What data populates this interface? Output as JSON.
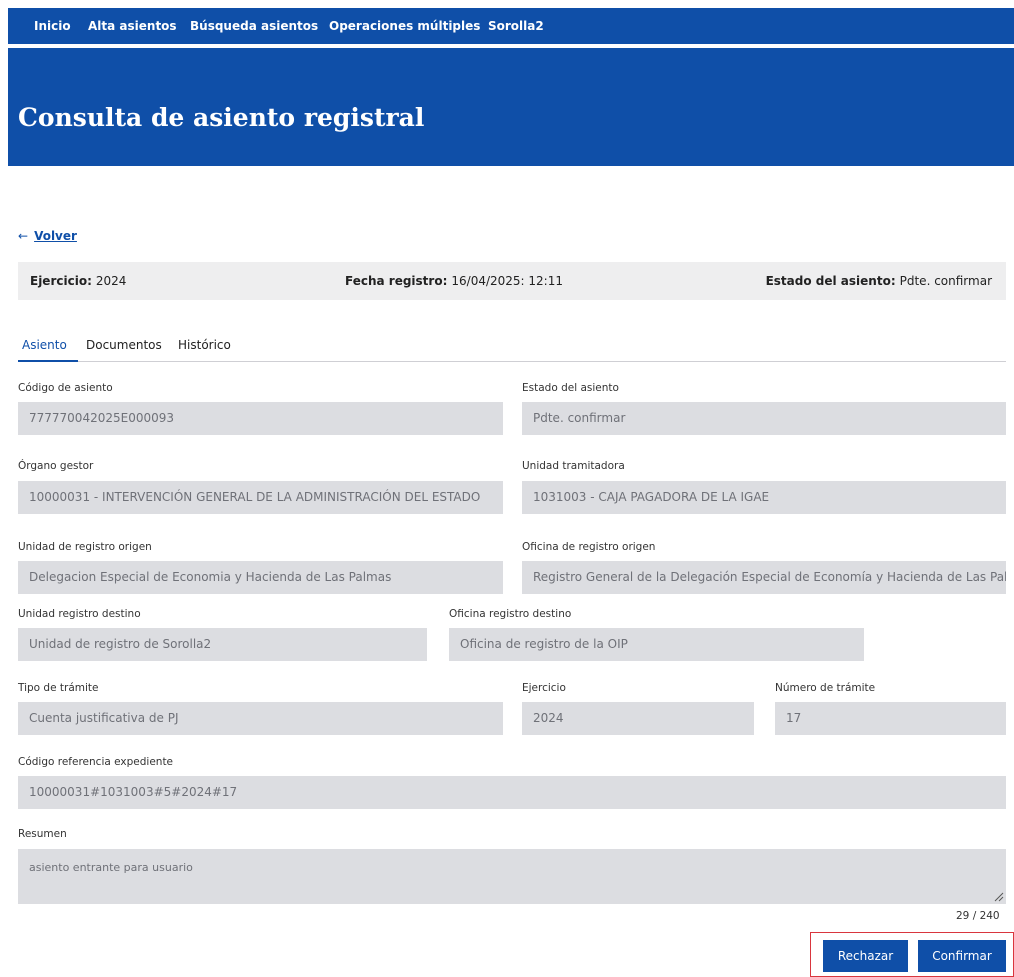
{
  "nav": {
    "items": [
      "Inicio",
      "Alta asientos",
      "Búsqueda asientos",
      "Operaciones múltiples",
      "Sorolla2"
    ]
  },
  "page": {
    "title": "Consulta de asiento registral",
    "back_arrow": "←",
    "back_label": "Volver"
  },
  "summary": {
    "ejercicio_label": "Ejercicio:",
    "ejercicio_value": "2024",
    "fecha_label": "Fecha registro:",
    "fecha_value": "16/04/2025: 12:11",
    "estado_label": "Estado del asiento:",
    "estado_value": "Pdte. confirmar"
  },
  "tabs": [
    "Asiento",
    "Documentos",
    "Histórico"
  ],
  "fields": {
    "codigo_asiento": {
      "label": "Código de asiento",
      "value": "777770042025E000093"
    },
    "estado_asiento": {
      "label": "Estado del asiento",
      "value": "Pdte. confirmar"
    },
    "organo_gestor": {
      "label": "Órgano gestor",
      "value": "10000031 - INTERVENCIÓN GENERAL DE LA ADMINISTRACIÓN DEL ESTADO"
    },
    "unidad_tramitadora": {
      "label": "Unidad tramitadora",
      "value": "1031003 - CAJA PAGADORA DE LA IGAE"
    },
    "unidad_registro_origen": {
      "label": "Unidad de registro origen",
      "value": "Delegacion Especial de Economia y Hacienda de Las Palmas"
    },
    "oficina_registro_origen": {
      "label": "Oficina de registro origen",
      "value": "Registro General de la Delegación Especial de Economía y Hacienda de Las Palmas"
    },
    "unidad_registro_destino": {
      "label": "Unidad registro destino",
      "value": "Unidad de registro de Sorolla2"
    },
    "oficina_registro_destino": {
      "label": "Oficina registro destino",
      "value": "Oficina de registro de la OIP"
    },
    "tipo_tramite": {
      "label": "Tipo de trámite",
      "value": "Cuenta justificativa de PJ"
    },
    "ejercicio": {
      "label": "Ejercicio",
      "value": "2024"
    },
    "numero_tramite": {
      "label": "Número de trámite",
      "value": "17"
    },
    "codigo_referencia": {
      "label": "Código referencia expediente",
      "value": "10000031#1031003#5#2024#17"
    },
    "resumen": {
      "label": "Resumen",
      "value": "asiento entrante para usuario"
    }
  },
  "resumen_counter": "29 / 240",
  "actions": {
    "reject_label": "Rechazar",
    "confirm_label": "Confirmar"
  },
  "colors": {
    "brand_blue": "#0f4fa8",
    "field_bg": "#dcdde1",
    "highlight_red": "#d9363e"
  }
}
